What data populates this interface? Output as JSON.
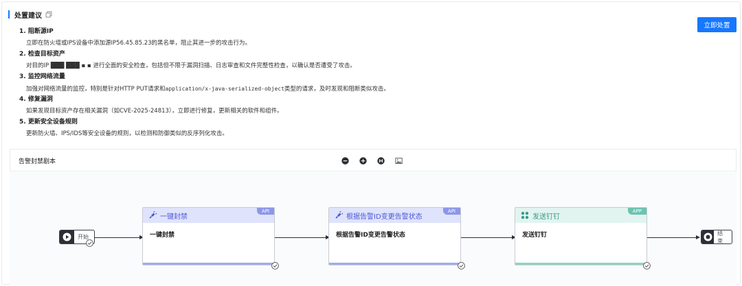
{
  "section": {
    "title": "处置建议"
  },
  "actions": {
    "dispose_label": "立即处置"
  },
  "recommendations": [
    {
      "title": "1. 阻断源IP",
      "desc": "立即在防火墙或IPS设备中添加源IP56.45.85.23的黑名单，阻止其进一步的攻击行为。"
    },
    {
      "title": "2. 检查目标资产",
      "desc": "对目的IP ███ ███ ▪ ▪ 进行全面的安全检查，包括但不限于漏洞扫描、日志审查和文件完整性检查，以确认是否遭受了攻击。"
    },
    {
      "title": "3. 监控网络流量",
      "desc_prefix": "加强对网络流量的监控，特别是针对HTTP PUT请求和",
      "desc_mono": "application/x-java-serialized-object",
      "desc_suffix": "类型的请求，及时发现和阻断类似攻击。"
    },
    {
      "title": "4. 修复漏洞",
      "desc": "如果发现目标资产存在相关漏洞（如CVE-2025-24813），立即进行修复，更新相关的软件和组件。"
    },
    {
      "title": "5. 更新安全设备规则",
      "desc": "更新防火墙、IPS/IDS等安全设备的规则，以检测和防御类似的反序列化攻击。"
    }
  ],
  "playbook": {
    "title": "告警封禁剧本",
    "tools": [
      "zoom-out-icon",
      "zoom-in-icon",
      "fit-view-icon",
      "image-export-icon"
    ],
    "start_label": "开始",
    "end_label": "结束",
    "nodes": [
      {
        "header": "一键封禁",
        "tag": "API",
        "body": "一键封禁",
        "kind": "api"
      },
      {
        "header": "根据告警ID变更告警状态",
        "tag": "API",
        "body": "根据告警ID变更告警状态",
        "kind": "api"
      },
      {
        "header": "发送钉钉",
        "tag": "APP",
        "body": "发送钉钉",
        "kind": "app"
      }
    ],
    "colors": {
      "api": "#4b57d6",
      "app": "#3b9b88",
      "primary": "#1677ff"
    }
  }
}
